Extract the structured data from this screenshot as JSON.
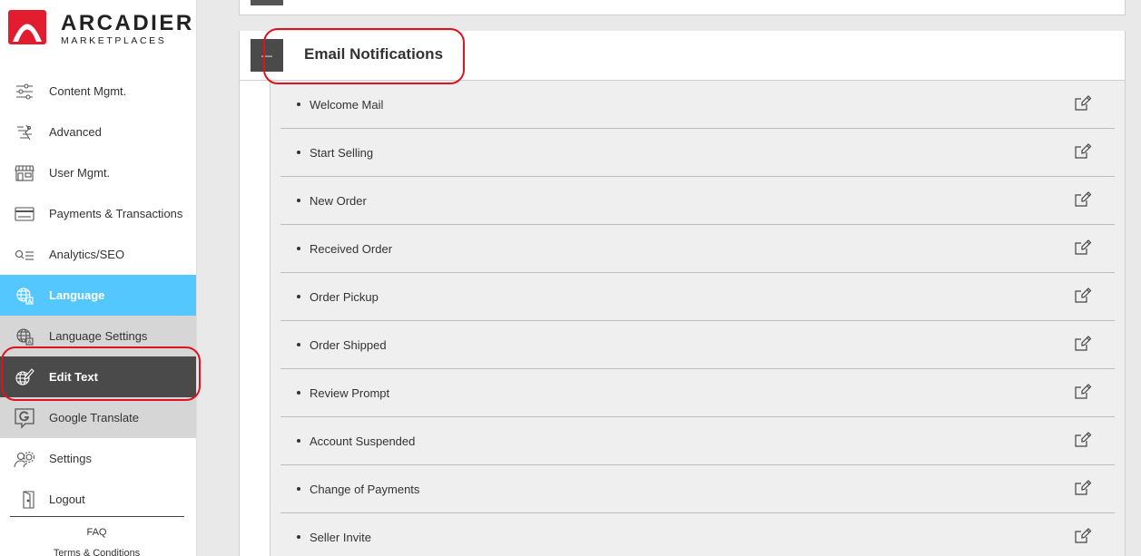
{
  "brand": {
    "name": "ARCADIER",
    "sub": "MARKETPLACES",
    "accent": "#e21d2f"
  },
  "sidebar": {
    "items": [
      {
        "label": "Content Mgmt.",
        "icon": "sliders-icon"
      },
      {
        "label": "Advanced",
        "icon": "advanced-icon"
      },
      {
        "label": "User Mgmt.",
        "icon": "storefront-icon"
      },
      {
        "label": "Payments & Transactions",
        "icon": "card-icon"
      },
      {
        "label": "Analytics/SEO",
        "icon": "analytics-icon"
      },
      {
        "label": "Language",
        "icon": "globe-icon",
        "state": "active"
      },
      {
        "label": "Language Settings",
        "icon": "globe-icon",
        "state": "sub"
      },
      {
        "label": "Edit Text",
        "icon": "edit-globe-icon",
        "state": "sub-active"
      },
      {
        "label": "Google Translate",
        "icon": "google-icon",
        "state": "sub"
      },
      {
        "label": "Settings",
        "icon": "users-gear-icon"
      },
      {
        "label": "Logout",
        "icon": "logout-icon"
      }
    ],
    "footer": {
      "faq": "FAQ",
      "terms": "Terms & Conditions"
    }
  },
  "main": {
    "panel": {
      "title": "Email Notifications",
      "collapse_symbol": "—",
      "items": [
        "Welcome Mail",
        "Start Selling",
        "New Order",
        "Received Order",
        "Order Pickup",
        "Order Shipped",
        "Review Prompt",
        "Account Suspended",
        "Change of Payments",
        "Seller Invite"
      ]
    }
  },
  "colors": {
    "active_bg": "#55c7ff",
    "sub_bg": "#d6d6d6",
    "sub_active_bg": "#4a4a4a",
    "highlight": "#e0121d"
  }
}
